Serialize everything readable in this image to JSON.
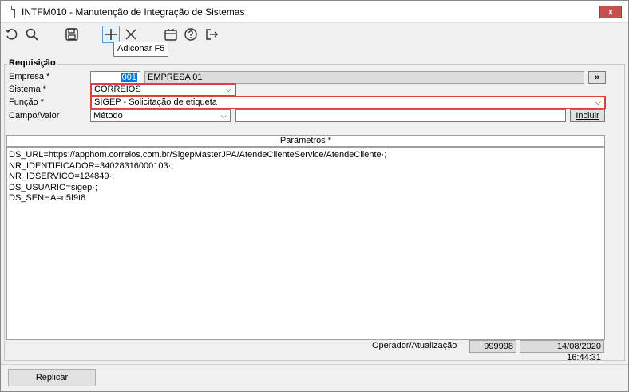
{
  "window": {
    "title": "INTFM010 - Manutenção de Integração de Sistemas",
    "close_label": "x"
  },
  "toolbar": {
    "icons": [
      "undo-icon",
      "search-icon",
      "save-icon",
      "add-icon",
      "delete-icon",
      "calendar-icon",
      "help-icon",
      "exit-icon"
    ],
    "tooltip": "Adiconar F5"
  },
  "group": {
    "title": "Requisição"
  },
  "form": {
    "empresa_label": "Empresa *",
    "empresa_code": "001",
    "empresa_name": "EMPRESA 01",
    "empresa_lookup": "»",
    "sistema_label": "Sistema *",
    "sistema_value": "CORREIOS",
    "funcao_label": "Função *",
    "funcao_value": "SIGEP - Solicitação de etiqueta",
    "campo_label": "Campo/Valor",
    "campo_value": "Método",
    "valor_value": "",
    "incluir_label": "Incluir"
  },
  "params": {
    "header": "Parâmetros *",
    "lines": [
      "DS_URL=https://apphom.correios.com.br/SigepMasterJPA/AtendeClienteService/AtendeCliente·;",
      "NR_IDENTIFICADOR=34028316000103·;",
      "NR_IDSERVICO=124849·;",
      "DS_USUARIO=sigep·;",
      "DS_SENHA=n5f9t8"
    ]
  },
  "status": {
    "label": "Operador/Atualização",
    "operator": "999998",
    "datetime": "14/08/2020 16:44:31"
  },
  "footer": {
    "replicar_label": "Replicar"
  },
  "colors": {
    "highlight": "#e0403a",
    "selection": "#0078d7"
  }
}
